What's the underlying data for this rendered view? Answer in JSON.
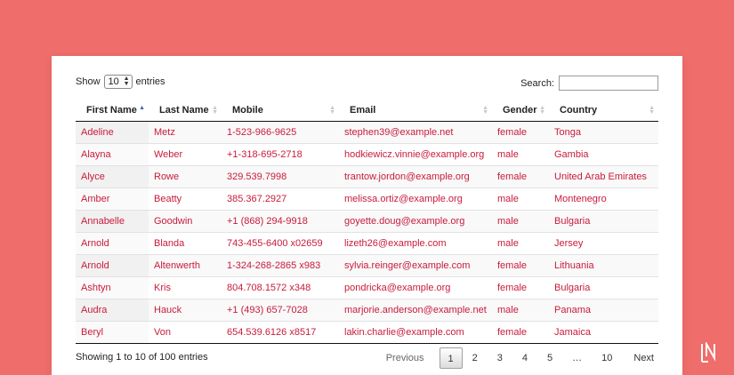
{
  "controls": {
    "show_label": "Show",
    "length_value": "10",
    "entries_label": "entries",
    "search_label": "Search:",
    "search_value": ""
  },
  "table": {
    "columns": [
      "First Name",
      "Last Name",
      "Mobile",
      "Email",
      "Gender",
      "Country"
    ],
    "rows": [
      [
        "Adeline",
        "Metz",
        "1-523-966-9625",
        "stephen39@example.net",
        "female",
        "Tonga"
      ],
      [
        "Alayna",
        "Weber",
        "+1-318-695-2718",
        "hodkiewicz.vinnie@example.org",
        "male",
        "Gambia"
      ],
      [
        "Alyce",
        "Rowe",
        "329.539.7998",
        "trantow.jordon@example.org",
        "female",
        "United Arab Emirates"
      ],
      [
        "Amber",
        "Beatty",
        "385.367.2927",
        "melissa.ortiz@example.org",
        "male",
        "Montenegro"
      ],
      [
        "Annabelle",
        "Goodwin",
        "+1 (868) 294-9918",
        "goyette.doug@example.org",
        "male",
        "Bulgaria"
      ],
      [
        "Arnold",
        "Blanda",
        "743-455-6400 x02659",
        "lizeth26@example.com",
        "male",
        "Jersey"
      ],
      [
        "Arnold",
        "Altenwerth",
        "1-324-268-2865 x983",
        "sylvia.reinger@example.com",
        "female",
        "Lithuania"
      ],
      [
        "Ashtyn",
        "Kris",
        "804.708.1572 x348",
        "pondricka@example.org",
        "female",
        "Bulgaria"
      ],
      [
        "Audra",
        "Hauck",
        "+1 (493) 657-7028",
        "marjorie.anderson@example.net",
        "male",
        "Panama"
      ],
      [
        "Beryl",
        "Von",
        "654.539.6126 x8517",
        "lakin.charlie@example.com",
        "female",
        "Jamaica"
      ]
    ]
  },
  "footer": {
    "info": "Showing 1 to 10 of 100 entries",
    "previous": "Previous",
    "next": "Next",
    "pages": [
      "1",
      "2",
      "3",
      "4",
      "5",
      "…",
      "10"
    ],
    "current_page": "1"
  },
  "colors": {
    "background": "#ef6d6a",
    "link_text": "#c81b3b",
    "sort_active": "#4a5cc2"
  },
  "icons": {
    "logo": "ln-logo-icon",
    "sort": "sort-arrows-icon",
    "select": "select-arrows-icon"
  }
}
